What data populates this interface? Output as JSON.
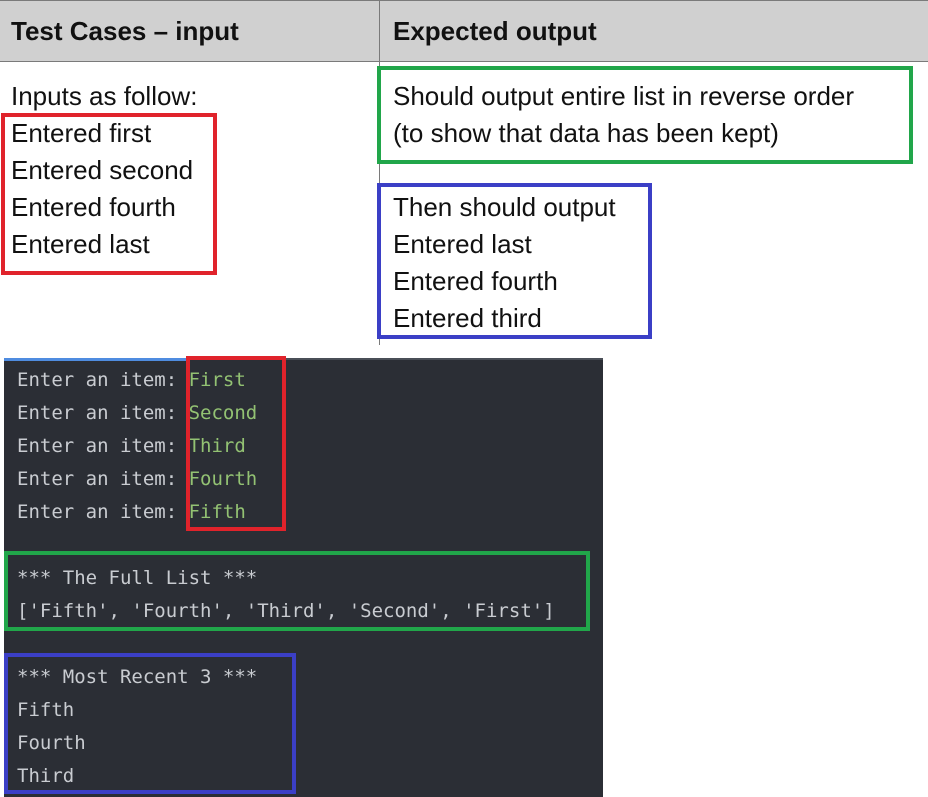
{
  "table": {
    "col1_header": "Test Cases – input",
    "col2_header": "Expected output",
    "col1_lines": [
      "Inputs as follow:",
      "Entered first",
      "Entered second",
      "Entered fourth",
      "Entered last"
    ],
    "col2_green_lines": [
      "Should output entire list in reverse order",
      "(to show that data has been kept)"
    ],
    "col2_blue_lines": [
      "Then should output",
      "Entered last",
      "Entered fourth",
      "Entered third"
    ]
  },
  "terminal": {
    "prompt": "Enter an item: ",
    "inputs": [
      "First",
      "Second",
      "Third",
      "Fourth",
      "Fifth"
    ],
    "full_list_heading": "*** The Full List ***",
    "full_list_value": "['Fifth', 'Fourth', 'Third', 'Second', 'First']",
    "recent_heading": "*** Most Recent 3 ***",
    "recent_items": [
      "Fifth",
      "Fourth",
      "Third"
    ]
  },
  "colors": {
    "red_box": "#e0232b",
    "green_box": "#21a64a",
    "blue_box": "#3b3fc6",
    "terminal_bg": "#2b2e35",
    "terminal_input": "#93c273"
  }
}
